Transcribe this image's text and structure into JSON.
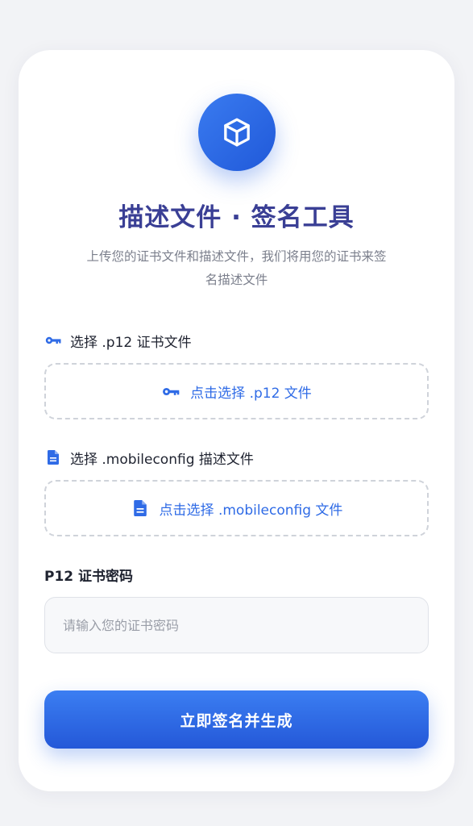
{
  "header": {
    "logo_icon": "cube-icon",
    "title": "描述文件 · 签名工具",
    "subtitle": "上传您的证书文件和描述文件，我们将用您的证书来签名描述文件"
  },
  "p12": {
    "label": "选择 .p12 证书文件",
    "label_icon": "key-icon",
    "dropzone_text": "点击选择 .p12 文件",
    "dropzone_icon": "key-icon"
  },
  "mobileconfig": {
    "label": "选择 .mobileconfig 描述文件",
    "label_icon": "file-icon",
    "dropzone_text": "点击选择 .mobileconfig 文件",
    "dropzone_icon": "file-icon"
  },
  "password": {
    "label": "P12 证书密码",
    "placeholder": "请输入您的证书密码",
    "value": ""
  },
  "submit": {
    "label": "立即签名并生成"
  },
  "colors": {
    "accent": "#2f6be6",
    "title": "#3a3f95",
    "subtitle": "#7b7f8c",
    "background": "#f2f3f6",
    "card": "#ffffff"
  }
}
